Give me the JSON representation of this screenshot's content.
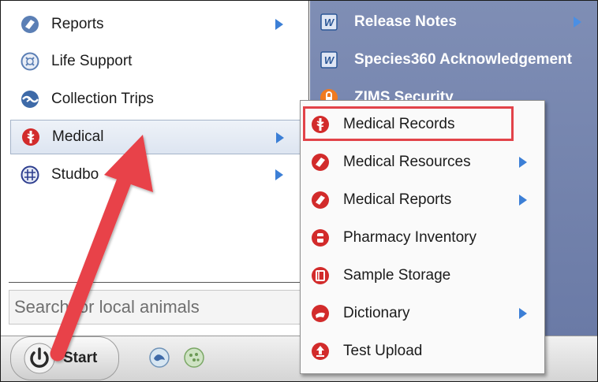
{
  "left_menu": {
    "items": [
      {
        "label": "Reports",
        "icon": "reports-icon",
        "has_submenu": true
      },
      {
        "label": "Life Support",
        "icon": "life-support-icon",
        "has_submenu": false
      },
      {
        "label": "Collection Trips",
        "icon": "collection-trips-icon",
        "has_submenu": false
      },
      {
        "label": "Medical",
        "icon": "medical-icon",
        "has_submenu": true,
        "selected": true
      },
      {
        "label": "Studbo",
        "icon": "studbook-icon",
        "has_submenu": true
      }
    ]
  },
  "right_panel": {
    "items": [
      {
        "label": "Release Notes",
        "icon": "word-doc-icon"
      },
      {
        "label": "Species360 Acknowledgement",
        "icon": "word-doc-icon"
      },
      {
        "label": "ZIMS Security",
        "icon": "security-icon"
      }
    ]
  },
  "search": {
    "placeholder": "Search for local animals"
  },
  "taskbar": {
    "start_label": "Start"
  },
  "medical_submenu": {
    "items": [
      {
        "label": "Medical Records",
        "icon": "medical-records-icon",
        "highlighted": true
      },
      {
        "label": "Medical Resources",
        "icon": "medical-resources-icon",
        "has_submenu": true
      },
      {
        "label": "Medical Reports",
        "icon": "medical-reports-icon",
        "has_submenu": true
      },
      {
        "label": "Pharmacy Inventory",
        "icon": "pharmacy-icon"
      },
      {
        "label": "Sample Storage",
        "icon": "sample-storage-icon"
      },
      {
        "label": "Dictionary",
        "icon": "dictionary-icon",
        "has_submenu": true
      },
      {
        "label": "Test Upload",
        "icon": "test-upload-icon"
      }
    ]
  },
  "colors": {
    "accent_arrow": "#e8434a",
    "highlight_border": "#e24349",
    "submenu_arrow": "#3c7fd6"
  }
}
